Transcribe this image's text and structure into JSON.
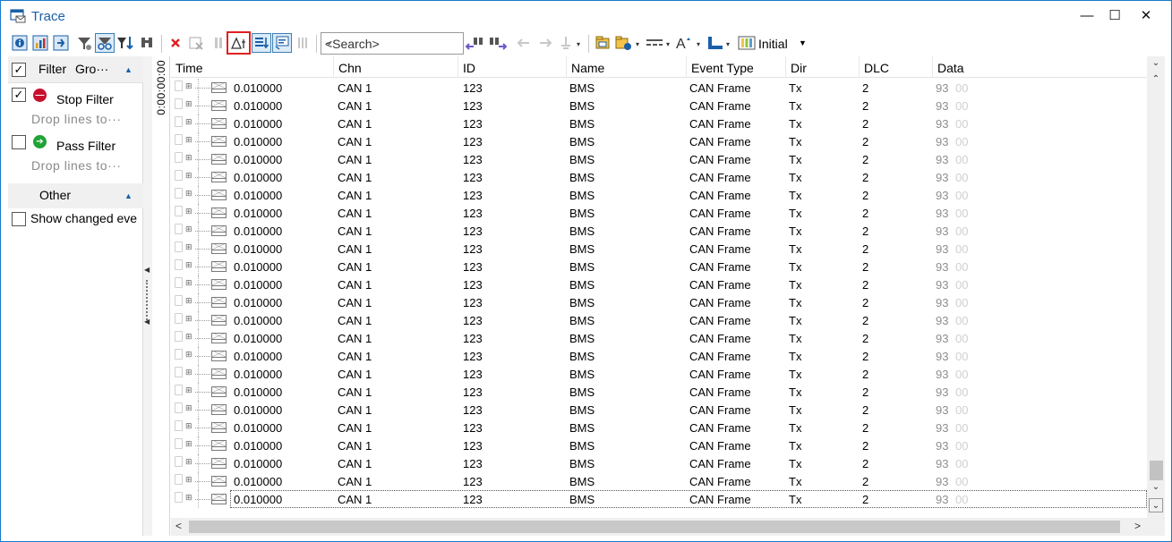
{
  "window": {
    "title": "Trace"
  },
  "toolbar": {
    "search_placeholder": "<Search>",
    "view_label": "Initial",
    "highlighted_tool": "delta-time-icon"
  },
  "filter_panel": {
    "header_label": "Filter",
    "header_group_label": "Gro···",
    "stop_filter": {
      "label": "Stop Filter",
      "hint": "Drop  lines  to···",
      "checked": true
    },
    "pass_filter": {
      "label": "Pass Filter",
      "hint": "Drop  lines  to···",
      "checked": false
    },
    "other_label": "Other",
    "show_changed_label": "Show changed eve"
  },
  "time_axis_label": "0:00:00:00",
  "grid": {
    "columns": [
      "Time",
      "Chn",
      "ID",
      "Name",
      "Event Type",
      "Dir",
      "DLC",
      "Data"
    ],
    "rows": [
      {
        "time": "0.010000",
        "chn": "CAN 1",
        "id": "123",
        "name": "BMS",
        "event_type": "CAN Frame",
        "dir": "Tx",
        "dlc": "2",
        "data1": "93",
        "data2": "00"
      },
      {
        "time": "0.010000",
        "chn": "CAN 1",
        "id": "123",
        "name": "BMS",
        "event_type": "CAN Frame",
        "dir": "Tx",
        "dlc": "2",
        "data1": "93",
        "data2": "00"
      },
      {
        "time": "0.010000",
        "chn": "CAN 1",
        "id": "123",
        "name": "BMS",
        "event_type": "CAN Frame",
        "dir": "Tx",
        "dlc": "2",
        "data1": "93",
        "data2": "00"
      },
      {
        "time": "0.010000",
        "chn": "CAN 1",
        "id": "123",
        "name": "BMS",
        "event_type": "CAN Frame",
        "dir": "Tx",
        "dlc": "2",
        "data1": "93",
        "data2": "00"
      },
      {
        "time": "0.010000",
        "chn": "CAN 1",
        "id": "123",
        "name": "BMS",
        "event_type": "CAN Frame",
        "dir": "Tx",
        "dlc": "2",
        "data1": "93",
        "data2": "00"
      },
      {
        "time": "0.010000",
        "chn": "CAN 1",
        "id": "123",
        "name": "BMS",
        "event_type": "CAN Frame",
        "dir": "Tx",
        "dlc": "2",
        "data1": "93",
        "data2": "00"
      },
      {
        "time": "0.010000",
        "chn": "CAN 1",
        "id": "123",
        "name": "BMS",
        "event_type": "CAN Frame",
        "dir": "Tx",
        "dlc": "2",
        "data1": "93",
        "data2": "00"
      },
      {
        "time": "0.010000",
        "chn": "CAN 1",
        "id": "123",
        "name": "BMS",
        "event_type": "CAN Frame",
        "dir": "Tx",
        "dlc": "2",
        "data1": "93",
        "data2": "00"
      },
      {
        "time": "0.010000",
        "chn": "CAN 1",
        "id": "123",
        "name": "BMS",
        "event_type": "CAN Frame",
        "dir": "Tx",
        "dlc": "2",
        "data1": "93",
        "data2": "00"
      },
      {
        "time": "0.010000",
        "chn": "CAN 1",
        "id": "123",
        "name": "BMS",
        "event_type": "CAN Frame",
        "dir": "Tx",
        "dlc": "2",
        "data1": "93",
        "data2": "00"
      },
      {
        "time": "0.010000",
        "chn": "CAN 1",
        "id": "123",
        "name": "BMS",
        "event_type": "CAN Frame",
        "dir": "Tx",
        "dlc": "2",
        "data1": "93",
        "data2": "00"
      },
      {
        "time": "0.010000",
        "chn": "CAN 1",
        "id": "123",
        "name": "BMS",
        "event_type": "CAN Frame",
        "dir": "Tx",
        "dlc": "2",
        "data1": "93",
        "data2": "00"
      },
      {
        "time": "0.010000",
        "chn": "CAN 1",
        "id": "123",
        "name": "BMS",
        "event_type": "CAN Frame",
        "dir": "Tx",
        "dlc": "2",
        "data1": "93",
        "data2": "00"
      },
      {
        "time": "0.010000",
        "chn": "CAN 1",
        "id": "123",
        "name": "BMS",
        "event_type": "CAN Frame",
        "dir": "Tx",
        "dlc": "2",
        "data1": "93",
        "data2": "00"
      },
      {
        "time": "0.010000",
        "chn": "CAN 1",
        "id": "123",
        "name": "BMS",
        "event_type": "CAN Frame",
        "dir": "Tx",
        "dlc": "2",
        "data1": "93",
        "data2": "00"
      },
      {
        "time": "0.010000",
        "chn": "CAN 1",
        "id": "123",
        "name": "BMS",
        "event_type": "CAN Frame",
        "dir": "Tx",
        "dlc": "2",
        "data1": "93",
        "data2": "00"
      },
      {
        "time": "0.010000",
        "chn": "CAN 1",
        "id": "123",
        "name": "BMS",
        "event_type": "CAN Frame",
        "dir": "Tx",
        "dlc": "2",
        "data1": "93",
        "data2": "00"
      },
      {
        "time": "0.010000",
        "chn": "CAN 1",
        "id": "123",
        "name": "BMS",
        "event_type": "CAN Frame",
        "dir": "Tx",
        "dlc": "2",
        "data1": "93",
        "data2": "00"
      },
      {
        "time": "0.010000",
        "chn": "CAN 1",
        "id": "123",
        "name": "BMS",
        "event_type": "CAN Frame",
        "dir": "Tx",
        "dlc": "2",
        "data1": "93",
        "data2": "00"
      },
      {
        "time": "0.010000",
        "chn": "CAN 1",
        "id": "123",
        "name": "BMS",
        "event_type": "CAN Frame",
        "dir": "Tx",
        "dlc": "2",
        "data1": "93",
        "data2": "00"
      },
      {
        "time": "0.010000",
        "chn": "CAN 1",
        "id": "123",
        "name": "BMS",
        "event_type": "CAN Frame",
        "dir": "Tx",
        "dlc": "2",
        "data1": "93",
        "data2": "00"
      },
      {
        "time": "0.010000",
        "chn": "CAN 1",
        "id": "123",
        "name": "BMS",
        "event_type": "CAN Frame",
        "dir": "Tx",
        "dlc": "2",
        "data1": "93",
        "data2": "00"
      },
      {
        "time": "0.010000",
        "chn": "CAN 1",
        "id": "123",
        "name": "BMS",
        "event_type": "CAN Frame",
        "dir": "Tx",
        "dlc": "2",
        "data1": "93",
        "data2": "00"
      },
      {
        "time": "0.010000",
        "chn": "CAN 1",
        "id": "123",
        "name": "BMS",
        "event_type": "CAN Frame",
        "dir": "Tx",
        "dlc": "2",
        "data1": "93",
        "data2": "00",
        "selected": true
      }
    ]
  },
  "colors": {
    "accent": "#1a5fa8",
    "window_border": "#1979ca",
    "highlight_box": "#e02020"
  }
}
